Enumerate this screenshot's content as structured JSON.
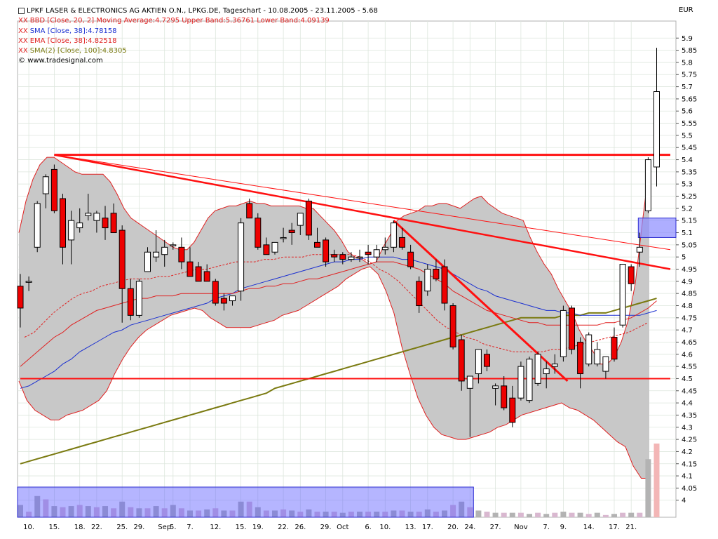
{
  "chart_data": {
    "type": "candlestick",
    "title": "LPKF LASER & ELECTRONICS AG AKTIEN O.N., LPKG.DE, Tageschart - 10.08.2005 - 23.11.2005 - 5.68",
    "currency": "EUR",
    "source": "www.tradesignal.com",
    "indicators": [
      {
        "label": "BBD [Close, 20, 2] Moving Average:4.7295 Upper Band:5.36761 Lower Band:4.09139",
        "color": "#e02020"
      },
      {
        "label": "SMA [Close, 38]:4.78158",
        "color": "#1a2fd0"
      },
      {
        "label": "EMA [Close, 38]:4.82518",
        "color": "#e02020"
      },
      {
        "label": "SMA(2) [Close, 100]:4.8305",
        "color": "#7a7a10"
      }
    ],
    "ylim": [
      3.93,
      5.97
    ],
    "y_ticks": [
      "5.9",
      "5.85",
      "5.8",
      "5.75",
      "5.7",
      "5.65",
      "5.6",
      "5.55",
      "5.5",
      "5.45",
      "5.4",
      "5.35",
      "5.3",
      "5.25",
      "5.2",
      "5.15",
      "5.1",
      "5.05",
      "5",
      "4.95",
      "4.9",
      "4.85",
      "4.8",
      "4.75",
      "4.7",
      "4.65",
      "4.6",
      "4.55",
      "4.5",
      "4.45",
      "4.4",
      "4.35",
      "4.3",
      "4.25",
      "4.2",
      "4.15",
      "4.1",
      "4.05",
      "4"
    ],
    "x_tick_labels": [
      {
        "i": 1,
        "label": "10."
      },
      {
        "i": 4,
        "label": "15."
      },
      {
        "i": 7,
        "label": "18."
      },
      {
        "i": 9,
        "label": "22."
      },
      {
        "i": 12,
        "label": "25."
      },
      {
        "i": 14,
        "label": "29."
      },
      {
        "i": 17,
        "label": "Sep"
      },
      {
        "i": 18,
        "label": "5."
      },
      {
        "i": 20,
        "label": "7."
      },
      {
        "i": 23,
        "label": "12."
      },
      {
        "i": 26,
        "label": "15."
      },
      {
        "i": 28,
        "label": "19."
      },
      {
        "i": 31,
        "label": "22."
      },
      {
        "i": 33,
        "label": "26."
      },
      {
        "i": 36,
        "label": "29."
      },
      {
        "i": 38,
        "label": "Oct"
      },
      {
        "i": 41,
        "label": "6."
      },
      {
        "i": 43,
        "label": "10."
      },
      {
        "i": 46,
        "label": "13."
      },
      {
        "i": 48,
        "label": "17."
      },
      {
        "i": 51,
        "label": "20."
      },
      {
        "i": 53,
        "label": "24."
      },
      {
        "i": 56,
        "label": "27."
      },
      {
        "i": 59,
        "label": "Nov"
      },
      {
        "i": 62,
        "label": "7."
      },
      {
        "i": 64,
        "label": "9."
      },
      {
        "i": 67,
        "label": "14."
      },
      {
        "i": 70,
        "label": "17."
      },
      {
        "i": 72,
        "label": "21."
      }
    ],
    "ohlc": [
      [
        4.88,
        4.93,
        4.71,
        4.79
      ],
      [
        4.9,
        4.92,
        4.86,
        4.9
      ],
      [
        5.04,
        5.23,
        5.02,
        5.22
      ],
      [
        5.26,
        5.34,
        5.2,
        5.33
      ],
      [
        5.36,
        5.38,
        5.18,
        5.19
      ],
      [
        5.24,
        5.26,
        4.97,
        5.04
      ],
      [
        5.07,
        5.19,
        4.97,
        5.15
      ],
      [
        5.12,
        5.2,
        5.1,
        5.14
      ],
      [
        5.17,
        5.26,
        5.15,
        5.18
      ],
      [
        5.15,
        5.19,
        5.1,
        5.18
      ],
      [
        5.16,
        5.21,
        5.07,
        5.12
      ],
      [
        5.18,
        5.22,
        5.11,
        5.1
      ],
      [
        5.11,
        5.13,
        4.73,
        4.87
      ],
      [
        4.87,
        4.91,
        4.74,
        4.76
      ],
      [
        4.76,
        4.91,
        4.75,
        4.9
      ],
      [
        4.94,
        5.04,
        4.96,
        5.02
      ],
      [
        5.0,
        5.11,
        4.98,
        5.02
      ],
      [
        5.01,
        5.07,
        4.96,
        5.04
      ],
      [
        5.05,
        5.06,
        5.03,
        5.05
      ],
      [
        5.04,
        5.08,
        4.95,
        4.98
      ],
      [
        4.98,
        5.04,
        4.93,
        4.92
      ],
      [
        4.96,
        4.98,
        4.9,
        4.9
      ],
      [
        4.94,
        4.97,
        4.91,
        4.9
      ],
      [
        4.9,
        4.91,
        4.8,
        4.81
      ],
      [
        4.83,
        4.85,
        4.78,
        4.81
      ],
      [
        4.82,
        4.84,
        4.8,
        4.84
      ],
      [
        4.86,
        5.16,
        4.82,
        5.14
      ],
      [
        5.22,
        5.24,
        5.17,
        5.16
      ],
      [
        5.16,
        5.18,
        5.03,
        5.04
      ],
      [
        5.05,
        5.08,
        5.01,
        5.01
      ],
      [
        5.02,
        5.06,
        5.01,
        5.06
      ],
      [
        5.08,
        5.12,
        5.06,
        5.08
      ],
      [
        5.11,
        5.14,
        5.05,
        5.1
      ],
      [
        5.13,
        5.15,
        5.09,
        5.18
      ],
      [
        5.23,
        5.24,
        5.07,
        5.09
      ],
      [
        5.06,
        5.12,
        5.04,
        5.04
      ],
      [
        5.07,
        5.08,
        4.96,
        4.98
      ],
      [
        5.01,
        5.03,
        4.98,
        5.0
      ],
      [
        5.01,
        5.02,
        4.97,
        4.99
      ],
      [
        4.99,
        5.02,
        4.98,
        5.0
      ],
      [
        5.0,
        5.03,
        4.98,
        5.0
      ],
      [
        5.02,
        5.05,
        4.97,
        5.01
      ],
      [
        5.0,
        5.05,
        4.98,
        5.03
      ],
      [
        5.03,
        5.08,
        5.01,
        5.04
      ],
      [
        5.04,
        5.15,
        5.02,
        5.14
      ],
      [
        5.08,
        5.12,
        5.03,
        5.04
      ],
      [
        5.02,
        5.05,
        4.95,
        4.96
      ],
      [
        4.9,
        4.92,
        4.77,
        4.8
      ],
      [
        4.86,
        4.97,
        4.84,
        4.95
      ],
      [
        4.95,
        4.99,
        4.9,
        4.91
      ],
      [
        4.96,
        4.99,
        4.78,
        4.81
      ],
      [
        4.8,
        4.81,
        4.62,
        4.63
      ],
      [
        4.66,
        4.68,
        4.45,
        4.49
      ],
      [
        4.46,
        4.47,
        4.26,
        4.51
      ],
      [
        4.52,
        4.62,
        4.48,
        4.62
      ],
      [
        4.6,
        4.62,
        4.53,
        4.55
      ],
      [
        4.46,
        4.48,
        4.39,
        4.47
      ],
      [
        4.47,
        4.51,
        4.37,
        4.38
      ],
      [
        4.42,
        4.47,
        4.3,
        4.32
      ],
      [
        4.42,
        4.57,
        4.41,
        4.55
      ],
      [
        4.41,
        4.59,
        4.4,
        4.58
      ],
      [
        4.48,
        4.61,
        4.47,
        4.6
      ],
      [
        4.52,
        4.57,
        4.46,
        4.54
      ],
      [
        4.55,
        4.6,
        4.52,
        4.56
      ],
      [
        4.59,
        4.8,
        4.57,
        4.78
      ],
      [
        4.79,
        4.8,
        4.6,
        4.62
      ],
      [
        4.65,
        4.67,
        4.46,
        4.52
      ],
      [
        4.56,
        4.69,
        4.55,
        4.68
      ],
      [
        4.56,
        4.65,
        4.55,
        4.62
      ],
      [
        4.53,
        4.58,
        4.5,
        4.59
      ],
      [
        4.67,
        4.71,
        4.57,
        4.58
      ],
      [
        4.72,
        4.75,
        4.71,
        4.97
      ],
      [
        4.96,
        4.97,
        4.86,
        4.89
      ],
      [
        5.02,
        5.1,
        4.96,
        5.04
      ],
      [
        5.19,
        5.41,
        5.18,
        5.4
      ],
      [
        5.37,
        5.86,
        5.29,
        5.68
      ]
    ],
    "volume": [
      0.11,
      0.05,
      0.19,
      0.16,
      0.1,
      0.09,
      0.1,
      0.11,
      0.1,
      0.09,
      0.1,
      0.08,
      0.14,
      0.09,
      0.08,
      0.08,
      0.1,
      0.08,
      0.11,
      0.08,
      0.06,
      0.06,
      0.07,
      0.08,
      0.06,
      0.06,
      0.14,
      0.14,
      0.09,
      0.06,
      0.06,
      0.07,
      0.06,
      0.05,
      0.07,
      0.05,
      0.05,
      0.05,
      0.04,
      0.05,
      0.05,
      0.05,
      0.05,
      0.05,
      0.06,
      0.06,
      0.05,
      0.05,
      0.07,
      0.05,
      0.06,
      0.11,
      0.14,
      0.09,
      0.06,
      0.05,
      0.04,
      0.04,
      0.04,
      0.04,
      0.03,
      0.04,
      0.03,
      0.04,
      0.05,
      0.04,
      0.04,
      0.03,
      0.04,
      0.02,
      0.03,
      0.04,
      0.04,
      0.04,
      0.52,
      0.66
    ],
    "volume_max": 0.66,
    "bands": {
      "upper": [
        5.1,
        5.23,
        5.32,
        5.38,
        5.41,
        5.41,
        5.39,
        5.37,
        5.35,
        5.34,
        5.34,
        5.34,
        5.34,
        5.31,
        5.26,
        5.2,
        5.16,
        5.14,
        5.12,
        5.1,
        5.08,
        5.06,
        5.04,
        5.03,
        5.03,
        5.06,
        5.11,
        5.16,
        5.19,
        5.2,
        5.21,
        5.21,
        5.22,
        5.23,
        5.22,
        5.22,
        5.21,
        5.21,
        5.21,
        5.21,
        5.21,
        5.2,
        5.2,
        5.17,
        5.14,
        5.11,
        5.07,
        5.02,
        5.0,
        4.99,
        4.97,
        4.98,
        5.04,
        5.09,
        5.15,
        5.17,
        5.18,
        5.19,
        5.21,
        5.21,
        5.22,
        5.22,
        5.21,
        5.2,
        5.22,
        5.24,
        5.25,
        5.22,
        5.2,
        5.18,
        5.17,
        5.16,
        5.15,
        5.08,
        5.02,
        4.97,
        4.93,
        4.87,
        4.82,
        4.77,
        4.7,
        4.65,
        4.61,
        4.56,
        4.56,
        4.59,
        4.65,
        4.74,
        4.89,
        5.14,
        5.37
      ],
      "lower": [
        4.49,
        4.41,
        4.37,
        4.35,
        4.33,
        4.33,
        4.35,
        4.36,
        4.37,
        4.39,
        4.41,
        4.45,
        4.52,
        4.58,
        4.63,
        4.67,
        4.7,
        4.72,
        4.74,
        4.76,
        4.77,
        4.78,
        4.79,
        4.78,
        4.75,
        4.73,
        4.71,
        4.71,
        4.71,
        4.71,
        4.72,
        4.73,
        4.74,
        4.76,
        4.77,
        4.78,
        4.8,
        4.82,
        4.84,
        4.86,
        4.88,
        4.91,
        4.93,
        4.95,
        4.96,
        4.93,
        4.86,
        4.77,
        4.63,
        4.52,
        4.42,
        4.35,
        4.3,
        4.27,
        4.26,
        4.25,
        4.25,
        4.26,
        4.27,
        4.28,
        4.3,
        4.31,
        4.33,
        4.35,
        4.36,
        4.37,
        4.38,
        4.39,
        4.4,
        4.38,
        4.37,
        4.35,
        4.33,
        4.3,
        4.27,
        4.24,
        4.22,
        4.14,
        4.09,
        4.09
      ],
      "middle": [
        4.67,
        4.69,
        4.73,
        4.77,
        4.8,
        4.83,
        4.85,
        4.86,
        4.88,
        4.89,
        4.9,
        4.91,
        4.91,
        4.91,
        4.92,
        4.92,
        4.93,
        4.94,
        4.95,
        4.95,
        4.96,
        4.97,
        4.98,
        4.98,
        4.98,
        4.99,
        4.99,
        5.0,
        5.0,
        5.0,
        5.01,
        5.01,
        5.01,
        5.01,
        5.01,
        5.0,
        4.98,
        4.95,
        4.93,
        4.9,
        4.86,
        4.82,
        4.78,
        4.74,
        4.71,
        4.69,
        4.67,
        4.66,
        4.64,
        4.63,
        4.62,
        4.61,
        4.61,
        4.61,
        4.61,
        4.62,
        4.62,
        4.63,
        4.64,
        4.65,
        4.66,
        4.67,
        4.68,
        4.69,
        4.71,
        4.73
      ]
    },
    "sma38": [
      4.46,
      4.47,
      4.49,
      4.51,
      4.53,
      4.56,
      4.58,
      4.61,
      4.63,
      4.65,
      4.67,
      4.69,
      4.7,
      4.72,
      4.73,
      4.74,
      4.75,
      4.76,
      4.77,
      4.78,
      4.79,
      4.8,
      4.81,
      4.83,
      4.84,
      4.85,
      4.87,
      4.88,
      4.89,
      4.9,
      4.91,
      4.92,
      4.93,
      4.94,
      4.95,
      4.96,
      4.97,
      4.98,
      4.98,
      4.99,
      4.99,
      5.0,
      5.0,
      5.0,
      5.0,
      4.99,
      4.99,
      4.98,
      4.97,
      4.96,
      4.95,
      4.93,
      4.91,
      4.89,
      4.87,
      4.86,
      4.84,
      4.83,
      4.82,
      4.81,
      4.8,
      4.79,
      4.78,
      4.78,
      4.77,
      4.77,
      4.76,
      4.76,
      4.76,
      4.76,
      4.76,
      4.76,
      4.76,
      4.76,
      4.77,
      4.78
    ],
    "ema38": [
      4.55,
      4.58,
      4.61,
      4.64,
      4.67,
      4.69,
      4.72,
      4.74,
      4.76,
      4.78,
      4.79,
      4.8,
      4.81,
      4.82,
      4.83,
      4.83,
      4.84,
      4.84,
      4.84,
      4.85,
      4.85,
      4.85,
      4.85,
      4.85,
      4.85,
      4.85,
      4.86,
      4.87,
      4.87,
      4.88,
      4.88,
      4.89,
      4.89,
      4.9,
      4.91,
      4.91,
      4.92,
      4.93,
      4.94,
      4.95,
      4.96,
      4.97,
      4.98,
      4.98,
      4.98,
      4.97,
      4.96,
      4.95,
      4.93,
      4.91,
      4.89,
      4.86,
      4.84,
      4.82,
      4.8,
      4.78,
      4.77,
      4.76,
      4.75,
      4.74,
      4.73,
      4.73,
      4.72,
      4.72,
      4.72,
      4.72,
      4.72,
      4.72,
      4.72,
      4.73,
      4.73,
      4.74,
      4.75,
      4.77,
      4.79,
      4.82
    ],
    "sma100": [
      4.15,
      4.16,
      4.17,
      4.18,
      4.19,
      4.2,
      4.21,
      4.22,
      4.23,
      4.24,
      4.25,
      4.26,
      4.27,
      4.28,
      4.29,
      4.3,
      4.31,
      4.32,
      4.33,
      4.34,
      4.35,
      4.36,
      4.37,
      4.38,
      4.39,
      4.4,
      4.41,
      4.42,
      4.43,
      4.44,
      4.46,
      4.47,
      4.48,
      4.49,
      4.5,
      4.51,
      4.52,
      4.53,
      4.54,
      4.55,
      4.56,
      4.57,
      4.58,
      4.59,
      4.6,
      4.61,
      4.62,
      4.63,
      4.64,
      4.65,
      4.66,
      4.67,
      4.68,
      4.69,
      4.7,
      4.71,
      4.72,
      4.73,
      4.74,
      4.75,
      4.75,
      4.75,
      4.75,
      4.75,
      4.76,
      4.76,
      4.76,
      4.77,
      4.77,
      4.77,
      4.78,
      4.79,
      4.8,
      4.81,
      4.82,
      4.83
    ],
    "lines": [
      {
        "name": "resistance-horizontal",
        "from": [
          4,
          5.42
        ],
        "to": [
          78,
          5.42
        ],
        "width": 3
      },
      {
        "name": "support-horizontal",
        "from": [
          0,
          4.5
        ],
        "to": [
          78,
          4.5
        ],
        "width": 2
      },
      {
        "name": "downtrend-thick",
        "from": [
          4,
          5.42
        ],
        "to": [
          78,
          4.95
        ],
        "width": 2.5
      },
      {
        "name": "downtrend-thin",
        "from": [
          4,
          5.42
        ],
        "to": [
          78,
          5.03
        ],
        "width": 1
      },
      {
        "name": "steep-downtrend",
        "from": [
          44,
          5.15
        ],
        "to": [
          64.5,
          4.49
        ],
        "width": 3
      }
    ],
    "highlight_box": {
      "y_from": 5.08,
      "y_to": 5.16,
      "i_from": 73,
      "i_to": 78
    }
  }
}
